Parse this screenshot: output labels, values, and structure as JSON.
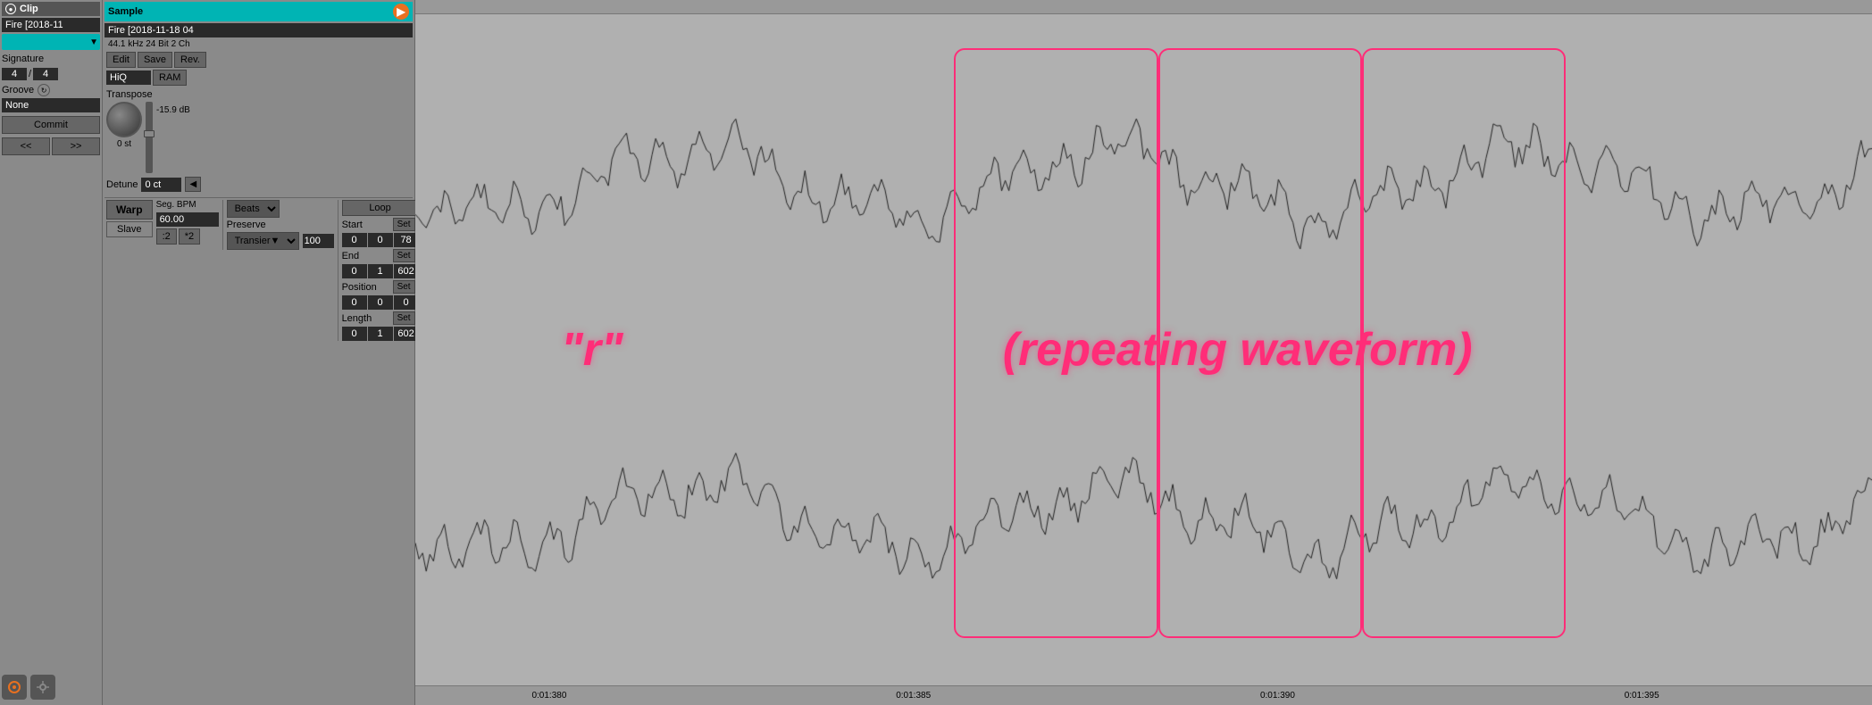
{
  "clip": {
    "header": "Clip",
    "clip_name": "Fire [2018-11",
    "signature_label": "Signature",
    "sig_num": "4",
    "sig_den": "4",
    "groove_label": "Groove",
    "groove_value": "None",
    "commit_label": "Commit",
    "nav_left": "<<",
    "nav_right": ">>"
  },
  "sample": {
    "header": "Sample",
    "file_name": "Fire [2018-11-18 04",
    "file_info": "44.1 kHz 24 Bit 2 Ch",
    "edit_label": "Edit",
    "save_label": "Save",
    "rev_label": "Rev.",
    "quality": "HiQ",
    "ram_label": "RAM",
    "transpose_label": "Transpose",
    "knob_value": "0 st",
    "db_value": "-15.9 dB",
    "detune_label": "Detune",
    "detune_value": "0 ct",
    "seg_bpm_label": "Seg. BPM",
    "seg_bpm_value": "60.00",
    "warp_label": "Warp",
    "slave_label": "Slave",
    "mult_half": ":2",
    "mult_double": "*2",
    "beats_label": "Beats",
    "preserve_label": "Preserve",
    "transient_label": "Transier▼",
    "loop_label": "Loop",
    "start_label": "Start",
    "start_set": "Set",
    "start_nums": [
      "0",
      "0",
      "78"
    ],
    "end_label": "End",
    "end_set": "Set",
    "end_nums": [
      "0",
      "1",
      "602"
    ],
    "position_label": "Position",
    "position_set": "Set",
    "pos_nums": [
      "0",
      "0",
      "0"
    ],
    "length_label": "Length",
    "length_set": "Set",
    "len_nums": [
      "0",
      "1",
      "602"
    ],
    "preserve_val": "100"
  },
  "waveform": {
    "r_label": "\"r\"",
    "repeating_label": "(repeating waveform)",
    "timeline": {
      "tick1_label": "0:01:380",
      "tick1_pos": "8%",
      "tick2_label": "0:01:385",
      "tick2_pos": "33%",
      "tick3_label": "0:01:390",
      "tick3_pos": "58%",
      "tick4_label": "0:01:395",
      "tick4_pos": "83%"
    },
    "loop_rects": [
      {
        "left": "37%",
        "top": "5%",
        "width": "14%",
        "height": "88%"
      },
      {
        "left": "51%",
        "top": "5%",
        "width": "14%",
        "height": "88%"
      },
      {
        "left": "65%",
        "top": "5%",
        "width": "14%",
        "height": "88%"
      }
    ]
  }
}
